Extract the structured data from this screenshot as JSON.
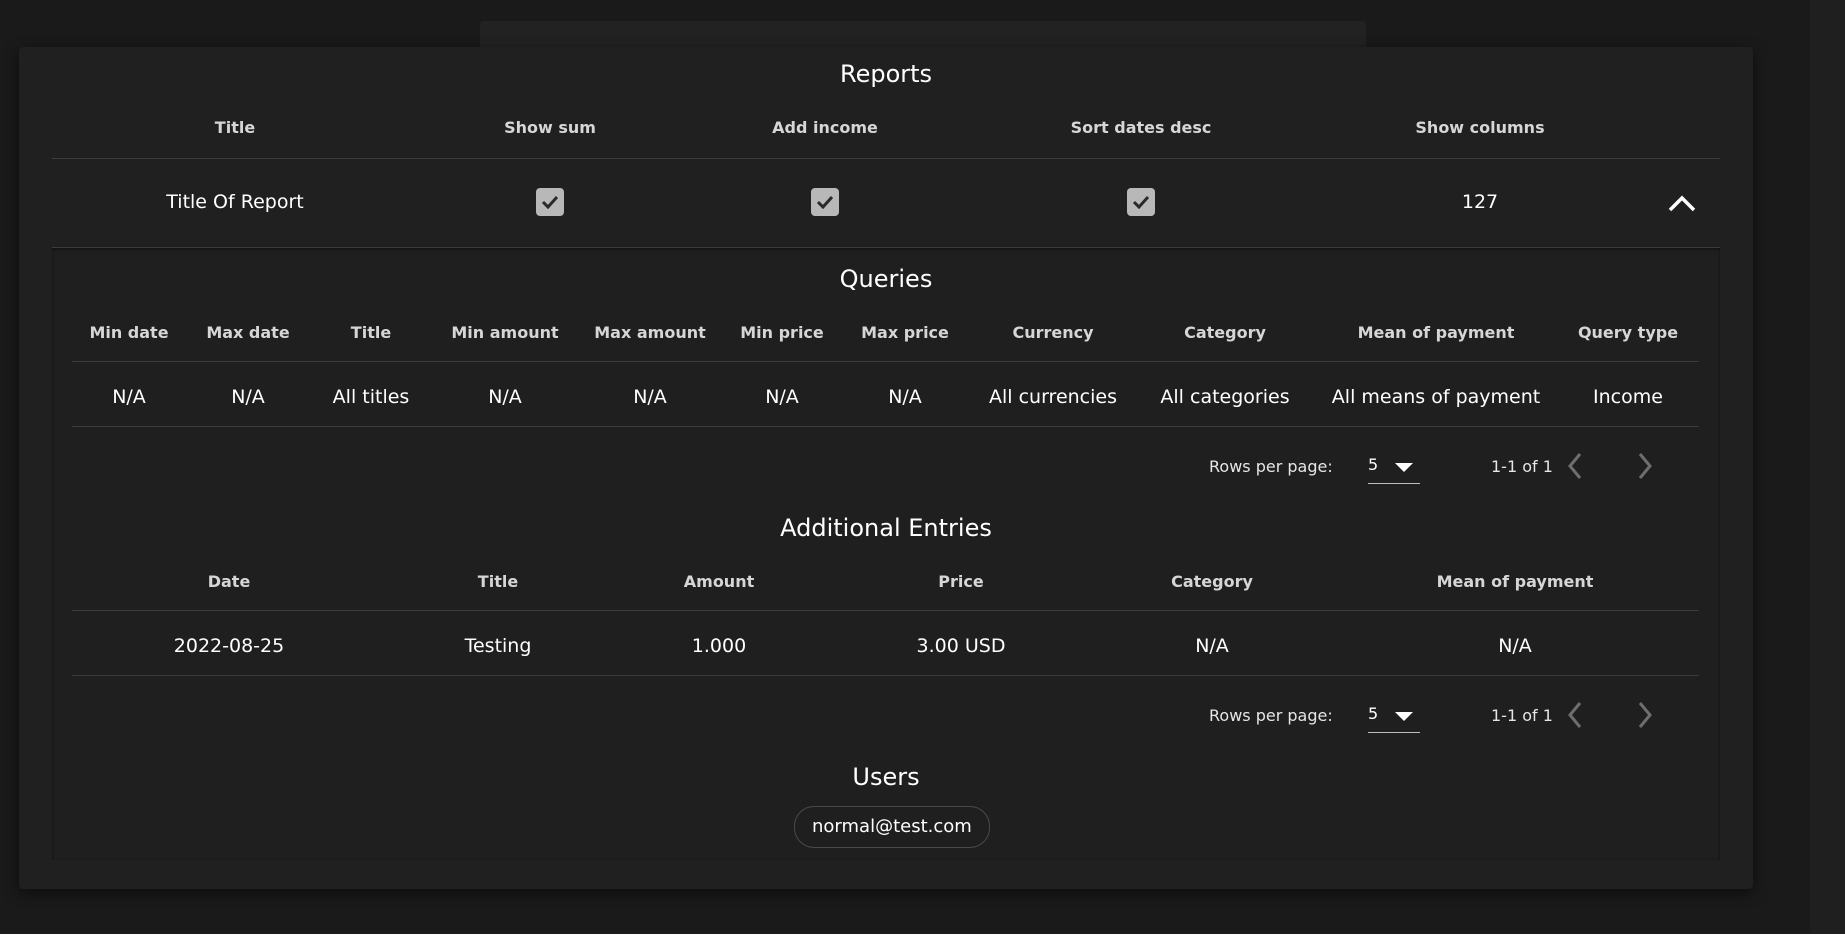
{
  "reports": {
    "title": "Reports",
    "headers": [
      "Title",
      "Show sum",
      "Add income",
      "Sort dates desc",
      "Show columns"
    ],
    "row": {
      "title": "Title Of Report",
      "show_sum": true,
      "add_income": true,
      "sort_dates_desc": true,
      "show_columns": "127",
      "expand_icon": "chevron-up-icon"
    }
  },
  "queries": {
    "title": "Queries",
    "headers": [
      "Min date",
      "Max date",
      "Title",
      "Min amount",
      "Max amount",
      "Min price",
      "Max price",
      "Currency",
      "Category",
      "Mean of payment",
      "Query type"
    ],
    "rows": [
      [
        "N/A",
        "N/A",
        "All titles",
        "N/A",
        "N/A",
        "N/A",
        "N/A",
        "All currencies",
        "All categories",
        "All means of payment",
        "Income"
      ]
    ],
    "pagination": {
      "rows_per_page_label": "Rows per page:",
      "rows_per_page": "5",
      "range": "1-1 of 1"
    }
  },
  "additional_entries": {
    "title": "Additional Entries",
    "headers": [
      "Date",
      "Title",
      "Amount",
      "Price",
      "Category",
      "Mean of payment"
    ],
    "rows": [
      [
        "2022-08-25",
        "Testing",
        "1.000",
        "3.00 USD",
        "N/A",
        "N/A"
      ]
    ],
    "pagination": {
      "rows_per_page_label": "Rows per page:",
      "rows_per_page": "5",
      "range": "1-1 of 1"
    }
  },
  "users": {
    "title": "Users",
    "items": [
      "normal@test.com"
    ]
  },
  "colors": {
    "background": "#1a1a1a",
    "card": "#202020",
    "checkbox": "#b8b8b8",
    "divider": "#3c3c3c"
  }
}
